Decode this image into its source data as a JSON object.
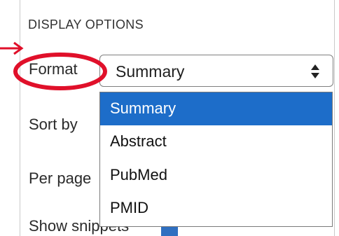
{
  "display_options": {
    "heading": "DISPLAY OPTIONS",
    "format": {
      "label": "Format",
      "selected_value": "Summary",
      "options": [
        "Summary",
        "Abstract",
        "PubMed",
        "PMID"
      ],
      "highlighted_option": "Summary"
    },
    "sort": {
      "label": "Sort by"
    },
    "per_page": {
      "label": "Per page"
    },
    "snippets": {
      "label": "Show snippets"
    }
  },
  "colors": {
    "highlight": "#1d6dc9",
    "annotation": "#e0102a"
  },
  "icons": {
    "select_arrows": "up-down-arrows-icon",
    "annotation_arrow": "arrow-right-icon"
  }
}
